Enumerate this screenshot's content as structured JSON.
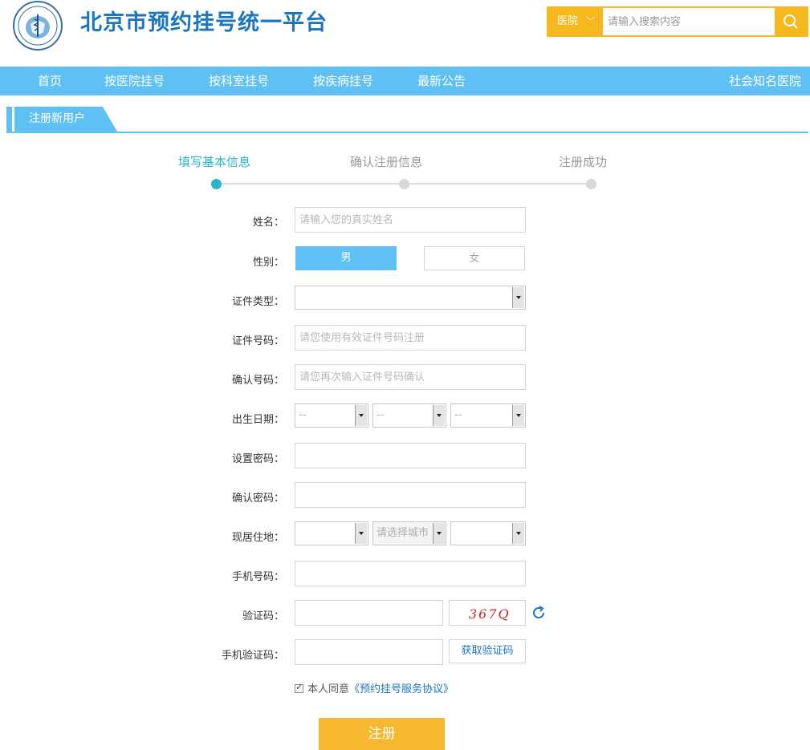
{
  "header": {
    "title": "北京市预约挂号统一平台",
    "logo_icon": "health-bureau-seal"
  },
  "search": {
    "type_label": "医院",
    "placeholder": "请输入搜索内容",
    "button_icon": "search-icon"
  },
  "nav": {
    "items": [
      "首页",
      "按医院挂号",
      "按科室挂号",
      "按疾病挂号",
      "最新公告"
    ],
    "right": "社会知名医院"
  },
  "section": {
    "title": "注册新用户"
  },
  "steps": {
    "items": [
      "填写基本信息",
      "确认注册信息",
      "注册成功"
    ],
    "active_index": 0,
    "colors": {
      "active": "#29b5c8",
      "inactive": "#999999"
    }
  },
  "form": {
    "name_label": "姓名：",
    "name_placeholder": "请输入您的真实姓名",
    "gender_label": "性别：",
    "gender_male": "男",
    "gender_female": "女",
    "id_type_label": "证件类型：",
    "id_type_value": "",
    "id_no_label": "证件号码：",
    "id_no_placeholder": "请您使用有效证件号码注册",
    "id_confirm_label": "确认号码：",
    "id_confirm_placeholder": "请您再次输入证件号码确认",
    "birth_label": "出生日期：",
    "birth_year": "--",
    "birth_month": "--",
    "birth_day": "--",
    "password_label": "设置密码：",
    "password_confirm_label": "确认密码：",
    "residence_label": "现居住地：",
    "residence_province": "",
    "residence_city": "请选择城市",
    "residence_district": "",
    "phone_label": "手机号码：",
    "captcha_label": "验证码：",
    "captcha_text": "367Q",
    "sms_label": "手机验证码：",
    "sms_button": "获取验证码",
    "agree_text": "本人同意",
    "agree_link": "《预约挂号服务协议》",
    "submit": "注册"
  },
  "colors": {
    "brand_blue": "#1b76c0",
    "nav_blue": "#5fc1f3",
    "accent_yellow": "#f6b81c"
  }
}
